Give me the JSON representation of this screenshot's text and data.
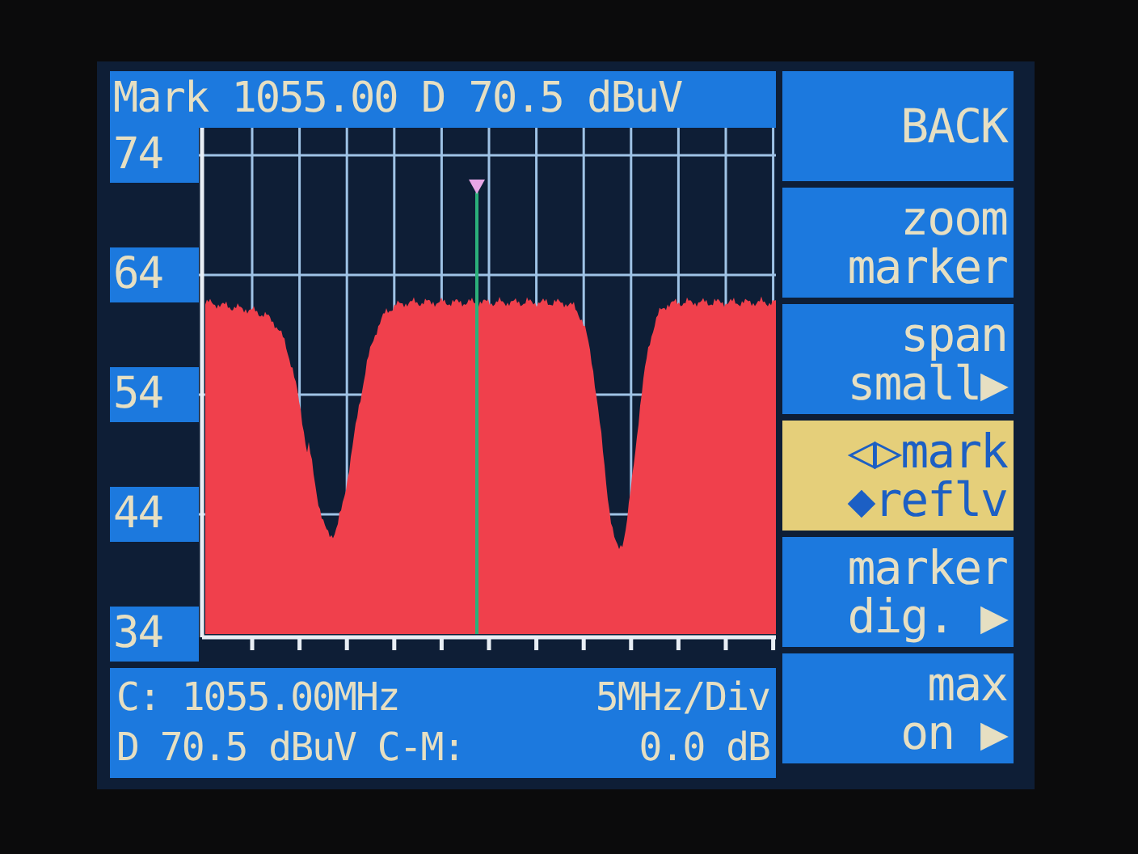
{
  "header": {
    "text": "Mark 1055.00 D 70.5 dBuV"
  },
  "y_labels": [
    "74",
    "64",
    "54",
    "44",
    "34"
  ],
  "info": {
    "line_1_left": "C: 1055.00MHz",
    "line_1_right": "5MHz/Div",
    "line_2_left": "D 70.5 dBuV C-M:",
    "line_2_right": "0.0 dB"
  },
  "buttons": [
    {
      "lines": [
        "BACK"
      ],
      "selected": false
    },
    {
      "lines": [
        "zoom",
        "marker"
      ],
      "selected": false
    },
    {
      "lines": [
        "span",
        "small▶"
      ],
      "selected": false
    },
    {
      "lines": [
        "◁▷mark",
        "◆reflv"
      ],
      "selected": true
    },
    {
      "lines": [
        "marker",
        "dig. ▶"
      ],
      "selected": false
    },
    {
      "lines": [
        "max",
        "on ▶"
      ],
      "selected": false
    }
  ]
}
